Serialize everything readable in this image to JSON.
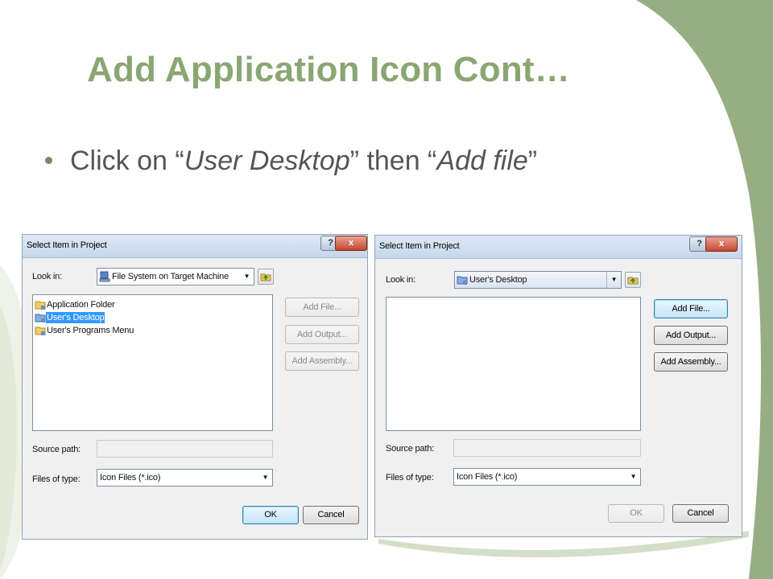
{
  "slide": {
    "title": "Add Application Icon Cont…",
    "bullet": {
      "prefix": "Click on “",
      "emphasis1": "User Desktop",
      "middle": "” then “",
      "emphasis2": "Add file",
      "suffix": "”"
    }
  },
  "colors": {
    "title": "#8aa672",
    "accent_green": "#97ae82",
    "selection": "#3399ff"
  },
  "dialog_left": {
    "title": "Select Item in Project",
    "help_label": "?",
    "close_label": "x",
    "look_in_label": "Look in:",
    "look_in_value": "File System on Target Machine",
    "tree_items": [
      "Application Folder",
      "User's Desktop",
      "User's Programs Menu"
    ],
    "selected_item": "User's Desktop",
    "buttons": {
      "add_file": "Add File...",
      "add_output": "Add Output...",
      "add_assembly": "Add Assembly...",
      "ok": "OK",
      "cancel": "Cancel"
    },
    "source_path_label": "Source path:",
    "source_path_value": "",
    "files_of_type_label": "Files of type:",
    "files_of_type_value": "Icon Files (*.ico)"
  },
  "dialog_right": {
    "title": "Select Item in Project",
    "help_label": "?",
    "close_label": "x",
    "look_in_label": "Look in:",
    "look_in_value": "User's Desktop",
    "buttons": {
      "add_file": "Add File...",
      "add_output": "Add Output...",
      "add_assembly": "Add Assembly...",
      "ok": "OK",
      "cancel": "Cancel"
    },
    "source_path_label": "Source path:",
    "source_path_value": "",
    "files_of_type_label": "Files of type:",
    "files_of_type_value": "Icon Files (*.ico)"
  }
}
